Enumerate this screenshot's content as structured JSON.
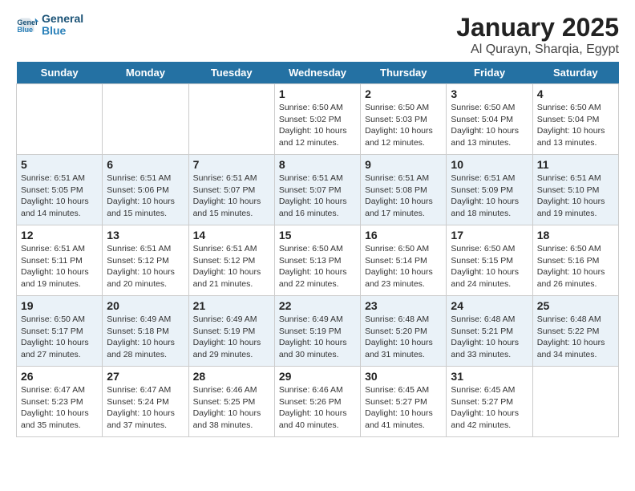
{
  "header": {
    "logo_line1": "General",
    "logo_line2": "Blue",
    "title": "January 2025",
    "subtitle": "Al Qurayn, Sharqia, Egypt"
  },
  "days_of_week": [
    "Sunday",
    "Monday",
    "Tuesday",
    "Wednesday",
    "Thursday",
    "Friday",
    "Saturday"
  ],
  "weeks": [
    [
      {
        "day": "",
        "info": ""
      },
      {
        "day": "",
        "info": ""
      },
      {
        "day": "",
        "info": ""
      },
      {
        "day": "1",
        "info": "Sunrise: 6:50 AM\nSunset: 5:02 PM\nDaylight: 10 hours\nand 12 minutes."
      },
      {
        "day": "2",
        "info": "Sunrise: 6:50 AM\nSunset: 5:03 PM\nDaylight: 10 hours\nand 12 minutes."
      },
      {
        "day": "3",
        "info": "Sunrise: 6:50 AM\nSunset: 5:04 PM\nDaylight: 10 hours\nand 13 minutes."
      },
      {
        "day": "4",
        "info": "Sunrise: 6:50 AM\nSunset: 5:04 PM\nDaylight: 10 hours\nand 13 minutes."
      }
    ],
    [
      {
        "day": "5",
        "info": "Sunrise: 6:51 AM\nSunset: 5:05 PM\nDaylight: 10 hours\nand 14 minutes."
      },
      {
        "day": "6",
        "info": "Sunrise: 6:51 AM\nSunset: 5:06 PM\nDaylight: 10 hours\nand 15 minutes."
      },
      {
        "day": "7",
        "info": "Sunrise: 6:51 AM\nSunset: 5:07 PM\nDaylight: 10 hours\nand 15 minutes."
      },
      {
        "day": "8",
        "info": "Sunrise: 6:51 AM\nSunset: 5:07 PM\nDaylight: 10 hours\nand 16 minutes."
      },
      {
        "day": "9",
        "info": "Sunrise: 6:51 AM\nSunset: 5:08 PM\nDaylight: 10 hours\nand 17 minutes."
      },
      {
        "day": "10",
        "info": "Sunrise: 6:51 AM\nSunset: 5:09 PM\nDaylight: 10 hours\nand 18 minutes."
      },
      {
        "day": "11",
        "info": "Sunrise: 6:51 AM\nSunset: 5:10 PM\nDaylight: 10 hours\nand 19 minutes."
      }
    ],
    [
      {
        "day": "12",
        "info": "Sunrise: 6:51 AM\nSunset: 5:11 PM\nDaylight: 10 hours\nand 19 minutes."
      },
      {
        "day": "13",
        "info": "Sunrise: 6:51 AM\nSunset: 5:12 PM\nDaylight: 10 hours\nand 20 minutes."
      },
      {
        "day": "14",
        "info": "Sunrise: 6:51 AM\nSunset: 5:12 PM\nDaylight: 10 hours\nand 21 minutes."
      },
      {
        "day": "15",
        "info": "Sunrise: 6:50 AM\nSunset: 5:13 PM\nDaylight: 10 hours\nand 22 minutes."
      },
      {
        "day": "16",
        "info": "Sunrise: 6:50 AM\nSunset: 5:14 PM\nDaylight: 10 hours\nand 23 minutes."
      },
      {
        "day": "17",
        "info": "Sunrise: 6:50 AM\nSunset: 5:15 PM\nDaylight: 10 hours\nand 24 minutes."
      },
      {
        "day": "18",
        "info": "Sunrise: 6:50 AM\nSunset: 5:16 PM\nDaylight: 10 hours\nand 26 minutes."
      }
    ],
    [
      {
        "day": "19",
        "info": "Sunrise: 6:50 AM\nSunset: 5:17 PM\nDaylight: 10 hours\nand 27 minutes."
      },
      {
        "day": "20",
        "info": "Sunrise: 6:49 AM\nSunset: 5:18 PM\nDaylight: 10 hours\nand 28 minutes."
      },
      {
        "day": "21",
        "info": "Sunrise: 6:49 AM\nSunset: 5:19 PM\nDaylight: 10 hours\nand 29 minutes."
      },
      {
        "day": "22",
        "info": "Sunrise: 6:49 AM\nSunset: 5:19 PM\nDaylight: 10 hours\nand 30 minutes."
      },
      {
        "day": "23",
        "info": "Sunrise: 6:48 AM\nSunset: 5:20 PM\nDaylight: 10 hours\nand 31 minutes."
      },
      {
        "day": "24",
        "info": "Sunrise: 6:48 AM\nSunset: 5:21 PM\nDaylight: 10 hours\nand 33 minutes."
      },
      {
        "day": "25",
        "info": "Sunrise: 6:48 AM\nSunset: 5:22 PM\nDaylight: 10 hours\nand 34 minutes."
      }
    ],
    [
      {
        "day": "26",
        "info": "Sunrise: 6:47 AM\nSunset: 5:23 PM\nDaylight: 10 hours\nand 35 minutes."
      },
      {
        "day": "27",
        "info": "Sunrise: 6:47 AM\nSunset: 5:24 PM\nDaylight: 10 hours\nand 37 minutes."
      },
      {
        "day": "28",
        "info": "Sunrise: 6:46 AM\nSunset: 5:25 PM\nDaylight: 10 hours\nand 38 minutes."
      },
      {
        "day": "29",
        "info": "Sunrise: 6:46 AM\nSunset: 5:26 PM\nDaylight: 10 hours\nand 40 minutes."
      },
      {
        "day": "30",
        "info": "Sunrise: 6:45 AM\nSunset: 5:27 PM\nDaylight: 10 hours\nand 41 minutes."
      },
      {
        "day": "31",
        "info": "Sunrise: 6:45 AM\nSunset: 5:27 PM\nDaylight: 10 hours\nand 42 minutes."
      },
      {
        "day": "",
        "info": ""
      }
    ]
  ]
}
